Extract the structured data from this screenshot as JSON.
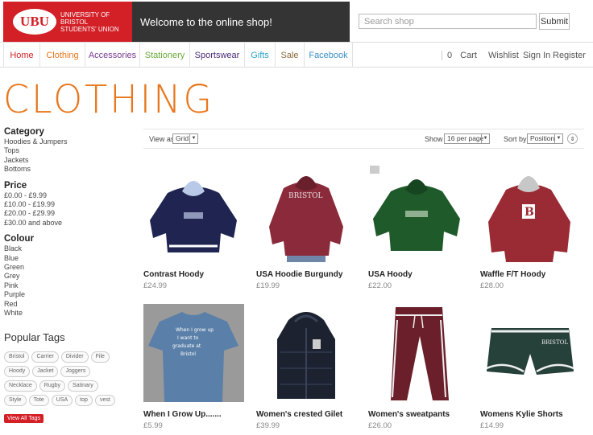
{
  "header": {
    "logo_short": "UBU",
    "logo_full": "UNIVERSITY OF BRISTOL STUDENTS' UNION",
    "welcome": "Welcome to the online shop!",
    "search_placeholder": "Search shop",
    "search_button": "Submit"
  },
  "nav": {
    "items": [
      {
        "label": "Home",
        "color": "#d31f26"
      },
      {
        "label": "Clothing",
        "color": "#e8761c"
      },
      {
        "label": "Accessories",
        "color": "#7a3b8f"
      },
      {
        "label": "Stationery",
        "color": "#6aaa3a"
      },
      {
        "label": "Sportswear",
        "color": "#4a2d7a"
      },
      {
        "label": "Gifts",
        "color": "#2ea3c9"
      },
      {
        "label": "Sale",
        "color": "#8a6a3a"
      },
      {
        "label": "Facebook",
        "color": "#3b8fc7"
      }
    ],
    "cart_count": "0",
    "cart": "Cart",
    "wishlist": "Wishlist",
    "sign_in": "Sign In",
    "register": "Register"
  },
  "page_title": "CLOTHING",
  "colors": {
    "title": "#e8761c",
    "brand_red": "#d31f26"
  },
  "sidebar": {
    "category_heading": "Category",
    "categories": [
      "Hoodies & Jumpers",
      "Tops",
      "Jackets",
      "Bottoms"
    ],
    "price_heading": "Price",
    "prices": [
      "£0.00 - £9.99",
      "£10.00 - £19.99",
      "£20.00 - £29.99",
      "£30.00 and above"
    ],
    "colour_heading": "Colour",
    "colours": [
      "Black",
      "Blue",
      "Green",
      "Grey",
      "Pink",
      "Purple",
      "Red",
      "White"
    ],
    "tags_heading": "Popular Tags",
    "tags": [
      "Bristol",
      "Carrier",
      "Divider",
      "File",
      "Hoody",
      "Jacket",
      "Joggers",
      "Necklace",
      "Rugby",
      "Satinary",
      "Style",
      "Tote",
      "USA",
      "top",
      "vest"
    ],
    "view_all": "View All Tags"
  },
  "toolbar": {
    "view_as_label": "View as",
    "view_as_value": "Grid",
    "show_label": "Show",
    "show_value": "16 per page",
    "sort_label": "Sort by",
    "sort_value": "Position"
  },
  "products": [
    {
      "name": "Contrast Hoody",
      "price": "£24.99",
      "icon": "navy-hoodie",
      "color": "#1f2550"
    },
    {
      "name": "USA Hoodie Burgundy",
      "price": "£19.99",
      "icon": "burgundy-hoodie",
      "color": "#8a2a3a"
    },
    {
      "name": "USA Hoody",
      "price": "£22.00",
      "icon": "green-hoodie",
      "color": "#1f5a2a"
    },
    {
      "name": "Waffle F/T Hoody",
      "price": "£28.00",
      "icon": "red-hoodie",
      "color": "#9a2a34"
    },
    {
      "name": "When I Grow Up.......",
      "price": "£5.99",
      "icon": "blue-tshirt",
      "color": "#5a7fa8"
    },
    {
      "name": "Women's crested Gilet",
      "price": "£39.99",
      "icon": "navy-gilet",
      "color": "#1c2230"
    },
    {
      "name": "Women's sweatpants",
      "price": "£26.00",
      "icon": "maroon-sweatpants",
      "color": "#6a1f2a"
    },
    {
      "name": "Womens Kylie Shorts",
      "price": "£14.99",
      "icon": "green-shorts",
      "color": "#26403a"
    }
  ]
}
